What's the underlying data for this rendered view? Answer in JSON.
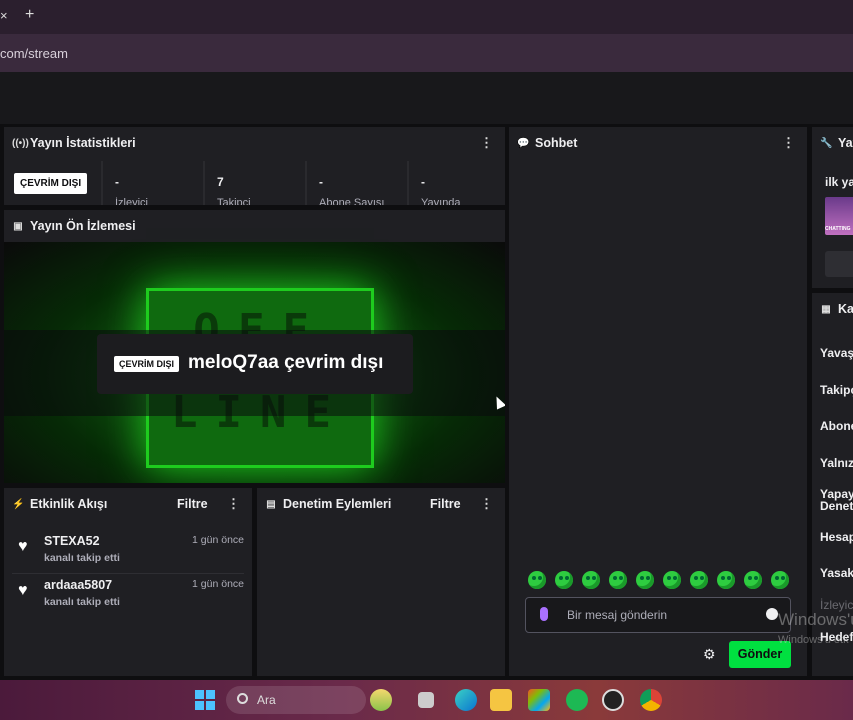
{
  "browser": {
    "url": "com/stream",
    "new_tab": "+",
    "tab_close": "×"
  },
  "stats": {
    "title": "Yayın İstatistikleri",
    "status_badge": "ÇEVRİM DIŞI",
    "items": [
      {
        "value": "-",
        "label": "İzleyici"
      },
      {
        "value": "7",
        "label": "Takipçi"
      },
      {
        "value": "-",
        "label": "Abone Sayısı"
      },
      {
        "value": "-",
        "label": "Yayında"
      }
    ]
  },
  "preview": {
    "title": "Yayın Ön İzlemesi",
    "badge": "ÇEVRİM DIŞI",
    "message": "meloQ7aa çevrim dışı",
    "art_top": "OFF",
    "art_bottom": "LINE"
  },
  "chat": {
    "title": "Sohbet",
    "placeholder": "Bir mesaj gönderin",
    "send_label": "Gönder"
  },
  "activity": {
    "title": "Etkinlik Akışı",
    "filter_label": "Filtre",
    "events": [
      {
        "name": "STEXA52",
        "action": "kanalı takip etti",
        "time": "1 gün önce"
      },
      {
        "name": "ardaaa5807",
        "action": "kanalı takip etti",
        "time": "1 gün önce"
      }
    ]
  },
  "moderation": {
    "title": "Denetim Eylemleri",
    "filter_label": "Filtre"
  },
  "right_top": {
    "title": "Yay",
    "subtitle": "ilk ya",
    "thumb_label": "CHATTING"
  },
  "right_bottom": {
    "title": "Ka",
    "items": [
      "Yavaş",
      "Takipç",
      "Abone",
      "Yalnız",
      "Yapay",
      "Denet",
      "Hesap",
      "Yasak",
      "İzleyic",
      "Hedef"
    ]
  },
  "watermark": {
    "line1": "Windows'u",
    "line2": "Windows'u etk"
  },
  "taskbar": {
    "search_label": "Ara"
  },
  "colors": {
    "accent_green": "#00e040",
    "mic_purple": "#a970ff",
    "bg": "#0e0e10",
    "panel": "#1f1f23"
  }
}
